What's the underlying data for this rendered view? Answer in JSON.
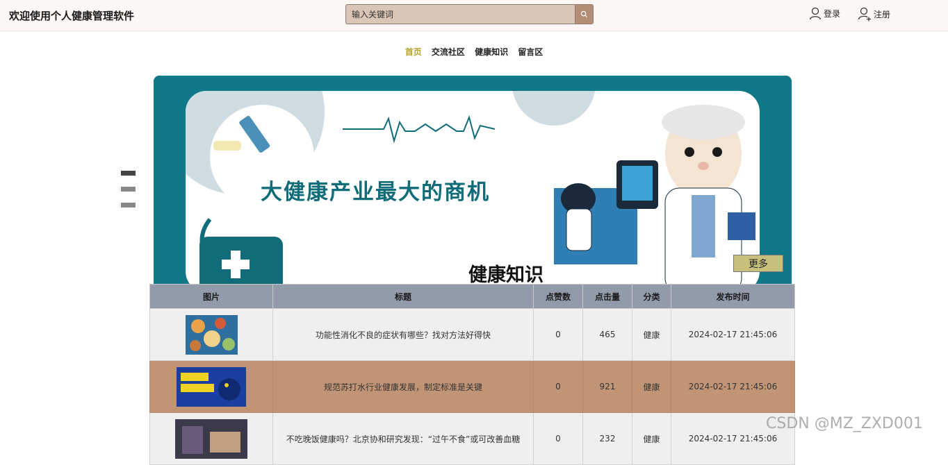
{
  "header": {
    "site_title": "欢迎使用个人健康管理软件",
    "search_placeholder": "输入关键词",
    "login_label": "登录",
    "register_label": "注册"
  },
  "nav": {
    "items": [
      "首页",
      "交流社区",
      "健康知识",
      "留言区"
    ],
    "active_index": 0
  },
  "carousel": {
    "slide_count": 3,
    "active_index": 0
  },
  "banner": {
    "headline": "大健康产业最大的商机"
  },
  "section": {
    "title": "健康知识",
    "more_label": "更多"
  },
  "table": {
    "columns": [
      "图片",
      "标题",
      "点赞数",
      "点击量",
      "分类",
      "发布时间"
    ],
    "rows": [
      {
        "title": "功能性消化不良的症状有哪些？找对方法好得快",
        "likes": "0",
        "clicks": "465",
        "category": "健康",
        "time": "2024-02-17 21:45:06"
      },
      {
        "title": "规范苏打水行业健康发展，制定标准是关键",
        "likes": "0",
        "clicks": "921",
        "category": "健康",
        "time": "2024-02-17 21:45:06"
      },
      {
        "title": "不吃晚饭健康吗？北京协和研究发现：“过午不食”或可改善血糖",
        "likes": "0",
        "clicks": "232",
        "category": "健康",
        "time": "2024-02-17 21:45:06"
      }
    ]
  },
  "watermark": "CSDN @MZ_ZXD001",
  "colors": {
    "nav_active": "#b5a42a",
    "banner_teal": "#0f7889",
    "row_highlight": "#c29476",
    "table_header": "#929ba9"
  }
}
